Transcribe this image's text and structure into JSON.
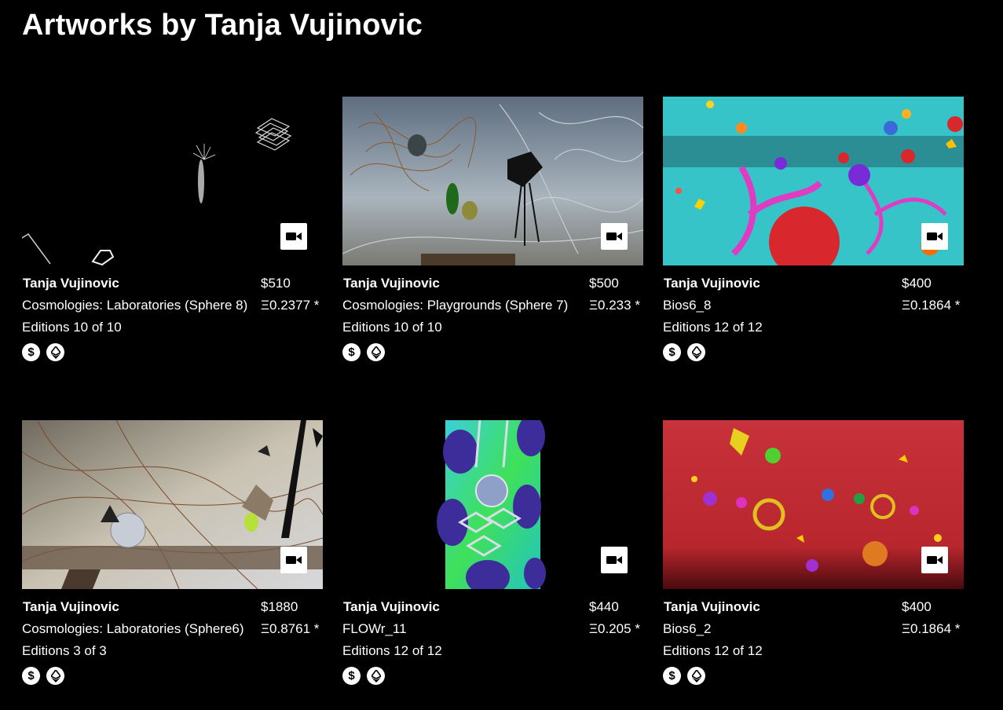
{
  "page": {
    "title": "Artworks by Tanja Vujinovic"
  },
  "icons": {
    "video": "video-camera-icon",
    "dollar": "dollar-icon",
    "ethereum": "ethereum-icon"
  },
  "artworks": [
    {
      "artist": "Tanja Vujinovic",
      "title": "Cosmologies: Laboratories (Sphere 8)",
      "price_usd": "$510",
      "price_eth": "Ξ0.2377 *",
      "editions": "Editions 10 of 10"
    },
    {
      "artist": "Tanja Vujinovic",
      "title": "Cosmologies: Playgrounds (Sphere 7)",
      "price_usd": "$500",
      "price_eth": "Ξ0.233 *",
      "editions": "Editions 10 of 10"
    },
    {
      "artist": "Tanja Vujinovic",
      "title": "Bios6_8",
      "price_usd": "$400",
      "price_eth": "Ξ0.1864 *",
      "editions": "Editions 12 of 12"
    },
    {
      "artist": "Tanja Vujinovic",
      "title": "Cosmologies: Laboratories (Sphere6)",
      "price_usd": "$1880",
      "price_eth": "Ξ0.8761 *",
      "editions": "Editions 3 of 3"
    },
    {
      "artist": "Tanja Vujinovic",
      "title": "FLOWr_11",
      "price_usd": "$440",
      "price_eth": "Ξ0.205 *",
      "editions": "Editions 12 of 12"
    },
    {
      "artist": "Tanja Vujinovic",
      "title": "Bios6_2",
      "price_usd": "$400",
      "price_eth": "Ξ0.1864 *",
      "editions": "Editions 12 of 12"
    }
  ]
}
